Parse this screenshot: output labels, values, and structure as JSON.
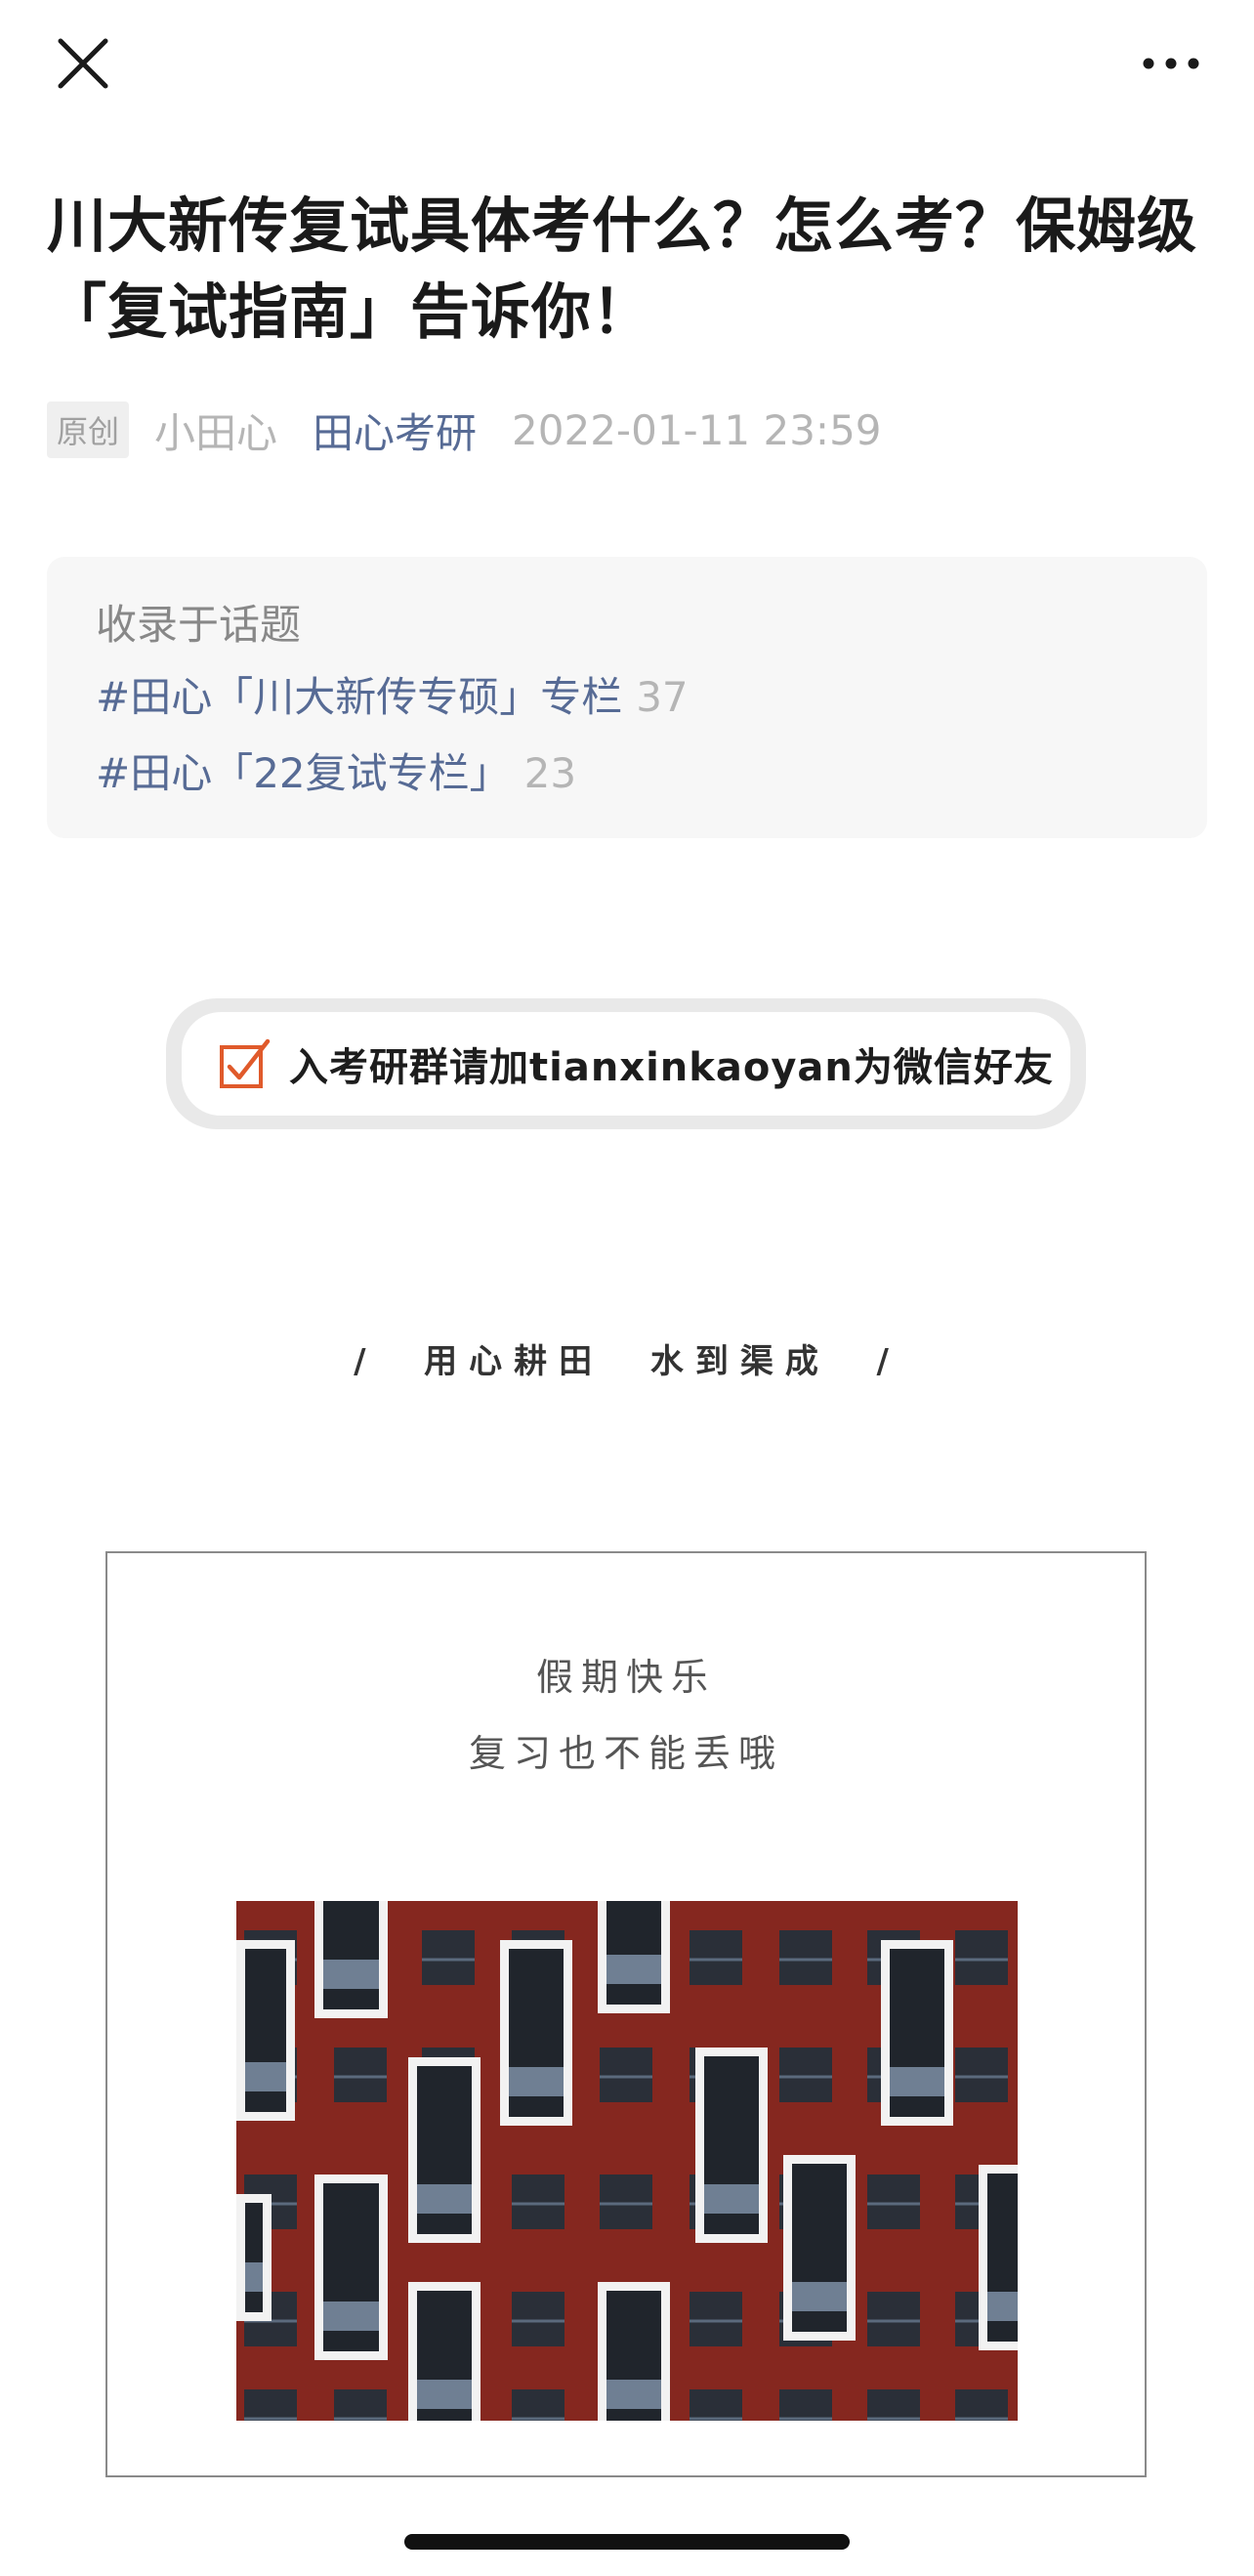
{
  "navigation": {
    "close_icon": "close-icon",
    "more_icon": "more-icon"
  },
  "article": {
    "title": "川大新传复试具体考什么？怎么考？保姆级「复试指南」告诉你！",
    "original_badge": "原创",
    "author": "小田心",
    "account_name": "田心考研",
    "publish_time": "2022-01-11 23:59"
  },
  "topics": {
    "heading": "收录于话题",
    "items": [
      {
        "label": "#田心「川大新传专硕」专栏",
        "count": "37"
      },
      {
        "label": "#田心「22复试专栏」",
        "count": "23"
      }
    ]
  },
  "group_banner": {
    "text": "入考研群请加tianxinkaoyan为微信好友",
    "check_icon": "checkbox-checked-icon"
  },
  "slogan": "/  用心耕田  水到渠成  /",
  "holiday_card": {
    "line1": "假期快乐",
    "line2": "复习也不能丢哦"
  },
  "colors": {
    "link": "#576b95",
    "muted": "#b5b5b5",
    "check_accent": "#e05a2b",
    "building_red": "#8e2a22"
  }
}
